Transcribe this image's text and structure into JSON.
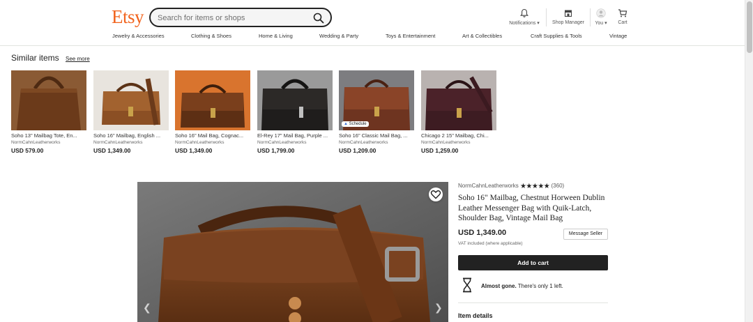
{
  "header": {
    "logo": "Etsy",
    "search_placeholder": "Search for items or shops",
    "notifications": "Notifications ▾",
    "shop_manager": "Shop Manager",
    "you": "You ▾",
    "cart": "Cart"
  },
  "categories": [
    "Jewelry & Accessories",
    "Clothing & Shoes",
    "Home & Living",
    "Wedding & Party",
    "Toys & Entertainment",
    "Art & Collectibles",
    "Craft Supplies & Tools",
    "Vintage"
  ],
  "similar": {
    "title": "Similar items",
    "see_more": "See more",
    "items": [
      {
        "title": "Soho 13\" Mailbag Tote, En...",
        "shop": "NormCahnLeatherworks",
        "price": "USD 579.00"
      },
      {
        "title": "Soho 16\" Mailbag, English ...",
        "shop": "NormCahnLeatherworks",
        "price": "USD 1,349.00"
      },
      {
        "title": "Soho 16\" Mail Bag, Cognac...",
        "shop": "NormCahnLeatherworks",
        "price": "USD 1,349.00"
      },
      {
        "title": "El-Rey 17\" Mail Bag, Purple ...",
        "shop": "NormCahnLeatherworks",
        "price": "USD 1,799.00"
      },
      {
        "title": "Soho 16\" Classic Mail Bag, ...",
        "shop": "NormCahnLeatherworks",
        "price": "USD 1,209.00",
        "badge": "Schedule"
      },
      {
        "title": "Chicago 2 15\" Mailbag, Chi...",
        "shop": "NormCahnLeatherworks",
        "price": "USD 1,259.00"
      }
    ]
  },
  "product": {
    "shop": "NormCahnLeatherworks",
    "stars": "★★★★★",
    "reviews": "(360)",
    "title": "Soho 16\" Mailbag, Chestnut Horween Dublin Leather Messenger Bag with Quik-Latch, Shoulder Bag, Vintage Mail Bag",
    "price": "USD 1,349.00",
    "message_seller": "Message Seller",
    "vat": "VAT included (where applicable)",
    "add_to_cart": "Add to cart",
    "almost_gone_bold": "Almost gone.",
    "almost_gone_rest": " There's only 1 left.",
    "item_details": "Item details"
  },
  "colors": {
    "brand": "#f1641e",
    "button": "#222222"
  }
}
